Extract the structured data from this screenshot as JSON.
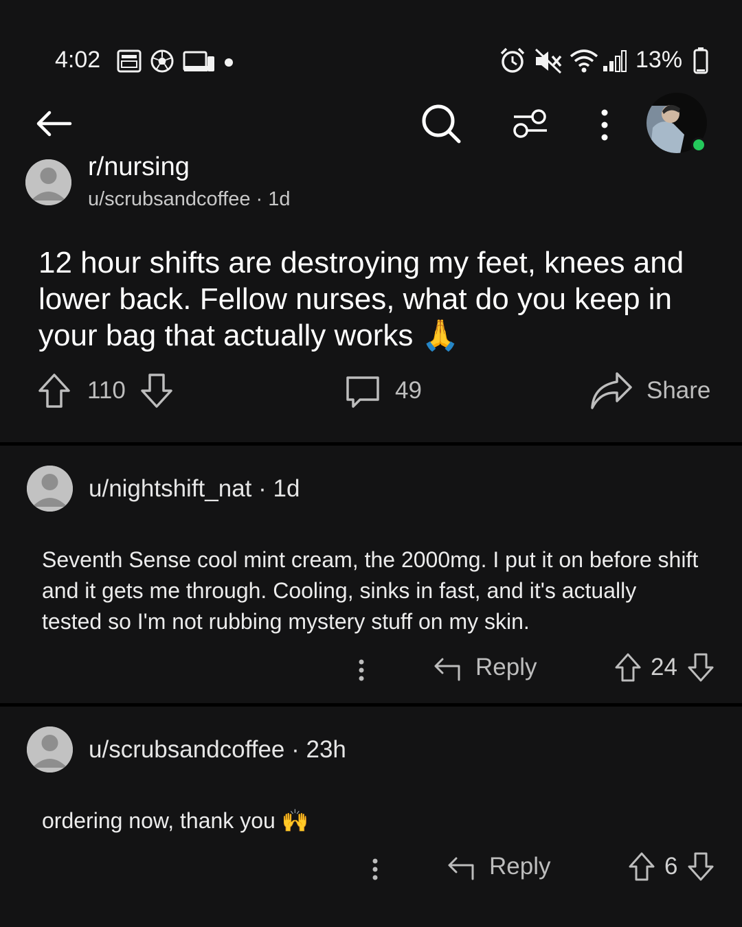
{
  "status_bar": {
    "time": "4:02",
    "battery_percent": "13%",
    "left_icons": [
      "gallery-icon",
      "soccer-ball-icon",
      "devices-icon",
      "dot-icon"
    ],
    "right_icons": [
      "alarm-icon",
      "mute-icon",
      "wifi-icon",
      "signal-icon",
      "battery-icon"
    ]
  },
  "toolbar": {
    "back_icon": "arrow-left-icon",
    "search_icon": "search-icon",
    "filter_icon": "sliders-icon",
    "more_icon": "kebab-icon",
    "online_color": "#24c85b"
  },
  "post": {
    "subreddit": "r/nursing",
    "meta": "u/scrubsandcoffee · 1d",
    "title": "12 hour shifts are destroying my feet, knees and lower back. Fellow nurses, what do you keep in your bag that actually works 🙏",
    "upvotes": "110",
    "comments": "49",
    "share_label": "Share"
  },
  "comments": [
    {
      "meta": "u/nightshift_nat · 1d",
      "body": "Seventh Sense cool mint cream, the 2000mg. I put it on before shift and it gets me through. Cooling, sinks in fast, and it's actually tested so I'm not rubbing mystery stuff on my skin.",
      "reply_label": "Reply",
      "score": "24"
    },
    {
      "meta": "u/scrubsandcoffee · 23h",
      "body": "ordering now, thank you 🙌",
      "reply_label": "Reply",
      "score": "6"
    }
  ]
}
